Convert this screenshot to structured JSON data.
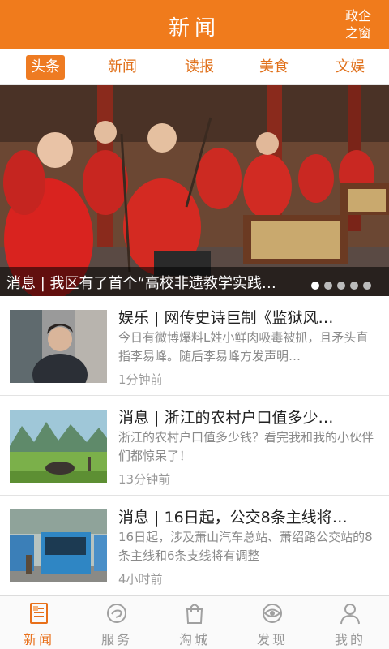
{
  "header": {
    "title": "新闻",
    "corner_line1": "政企",
    "corner_line2": "之窗"
  },
  "tabs": [
    {
      "label": "头条",
      "active": true
    },
    {
      "label": "新闻"
    },
    {
      "label": "读报"
    },
    {
      "label": "美食"
    },
    {
      "label": "文娱"
    }
  ],
  "banner": {
    "caption": "消息 | 我区有了首个“高校非遗教学实践…",
    "slide_count": 5,
    "active_slide": 1
  },
  "news": [
    {
      "headline": "娱乐 | 网传史诗巨制《监狱风…",
      "summary": "今日有微博爆料L姓小鲜肉吸毒被抓，且矛头直指李易峰。随后李易峰方发声明…",
      "time": "1分钟前"
    },
    {
      "headline": "消息 | 浙江的农村户口值多少…",
      "summary": "浙江的农村户口值多少钱？看完我和我的小伙伴们都惊呆了！",
      "time": "13分钟前"
    },
    {
      "headline": "消息 | 16日起，公交8条主线将…",
      "summary": "16日起，涉及萧山汽车总站、萧绍路公交站的8条主线和6条支线将有调整",
      "time": "4小时前"
    }
  ],
  "bottom_nav": [
    {
      "label": "新闻",
      "icon": "news-icon",
      "active": true
    },
    {
      "label": "服务",
      "icon": "service-icon"
    },
    {
      "label": "淘城",
      "icon": "shopping-bag-icon"
    },
    {
      "label": "发现",
      "icon": "eye-icon"
    },
    {
      "label": "我的",
      "icon": "person-icon"
    }
  ],
  "colors": {
    "accent": "#f07b1c",
    "active_text": "#e8701a",
    "inactive_icon": "#a0a0a0"
  }
}
